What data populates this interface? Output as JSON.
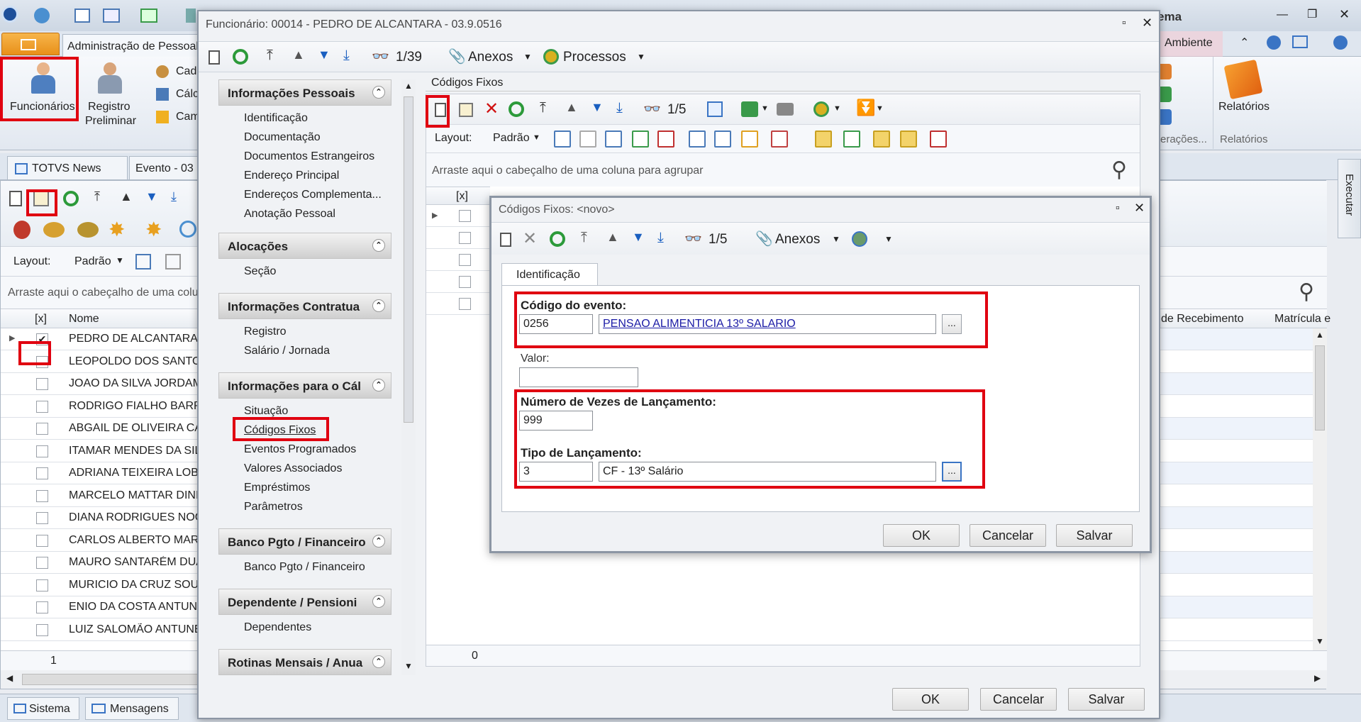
{
  "ribbon": {
    "active_tab": "Administração de Pessoal",
    "right_tabs": [
      "ema",
      "Ambiente"
    ],
    "buttons": {
      "funcionarios": "Funcionários",
      "registro_line1": "Registro",
      "registro_line2": "Preliminar",
      "cad": "Cad",
      "calc": "Cálc",
      "cam": "Cam",
      "relatorios": "Relatórios",
      "relatorios_group": "Relatórios",
      "operacoes_group": "erações..."
    }
  },
  "doc_tabs": [
    "TOTVS News",
    "Evento - 03"
  ],
  "bg_grid": {
    "layout_label": "Layout:",
    "layout_value": "Padrão",
    "group_hint": "Arraste aqui o cabeçalho de uma colu",
    "check_header": "[x]",
    "name_header": "Nome",
    "rows": [
      "PEDRO DE ALCANTARA",
      "LEOPOLDO DOS SANTOS",
      "JOAO DA SILVA JORDAM",
      "RODRIGO FIALHO BARRI",
      "ABGAIL DE OLIVEIRA CAR",
      "ITAMAR MENDES DA SILV",
      "ADRIANA TEIXEIRA LOBO",
      "MARCELO MATTAR DINIZ",
      "DIANA RODRIGUES NOGU",
      "CARLOS ALBERTO MARR",
      "MAURO SANTARÉM DUAR",
      "MURICIO DA CRUZ SOUT",
      "ENIO DA COSTA ANTUNE",
      "LUIZ SALOMÃO ANTUNES"
    ],
    "footer_count": "1",
    "right_col1": "de Recebimento",
    "right_col2": "Matrícula e"
  },
  "statusbar": {
    "sistema": "Sistema",
    "mensagens": "Mensagens"
  },
  "side_tab": "Executar",
  "func_window": {
    "title": "Funcionário: 00014 - PEDRO DE ALCANTARA - 03.9.0516",
    "nav": "1/39",
    "anexos": "Anexos",
    "processos": "Processos",
    "sections": [
      {
        "title": "Informações Pessoais",
        "items": [
          "Identificação",
          "Documentação",
          "Documentos Estrangeiros",
          "Endereço Principal",
          "Endereços Complementa...",
          "Anotação Pessoal"
        ]
      },
      {
        "title": "Alocações",
        "items": [
          "Seção"
        ]
      },
      {
        "title": "Informações Contratua",
        "items": [
          "Registro",
          "Salário / Jornada"
        ]
      },
      {
        "title": "Informações para o Cál",
        "items": [
          "Situação",
          "Códigos Fixos",
          "Eventos Programados",
          "Valores Associados",
          "Empréstimos",
          "Parâmetros"
        ]
      },
      {
        "title": "Banco Pgto / Financeiro",
        "items": [
          "Banco Pgto / Financeiro"
        ]
      },
      {
        "title": "Dependente / Pensioni",
        "items": [
          "Dependentes"
        ]
      },
      {
        "title": "Rotinas Mensais / Anua",
        "items": []
      }
    ],
    "codigos_fixos": {
      "group_title": "Códigos Fixos",
      "nav": "1/5",
      "layout_label": "Layout:",
      "layout_value": "Padrão",
      "group_hint": "Arraste aqui o cabeçalho de uma coluna para agrupar",
      "check_header": "[x]",
      "footer_count": "0"
    },
    "buttons": {
      "ok": "OK",
      "cancel": "Cancelar",
      "save": "Salvar"
    }
  },
  "dialog": {
    "title": "Códigos Fixos: <novo>",
    "nav": "1/5",
    "anexos": "Anexos",
    "tab": "Identificação",
    "codigo_label": "Código do evento:",
    "codigo_value": "0256",
    "codigo_desc": "PENSAO ALIMENTICIA 13º SALARIO",
    "valor_label": "Valor:",
    "valor_value": "",
    "vezes_label": "Número de Vezes de Lançamento:",
    "vezes_value": "999",
    "tipo_label": "Tipo de Lançamento:",
    "tipo_value": "3",
    "tipo_desc": "CF - 13º Salário",
    "ellipsis": "...",
    "buttons": {
      "ok": "OK",
      "cancel": "Cancelar",
      "save": "Salvar"
    }
  },
  "colors": {
    "accent_red": "#e00010",
    "ribbon_orange": "#f0a030",
    "link_blue": "#1a1aa6"
  }
}
